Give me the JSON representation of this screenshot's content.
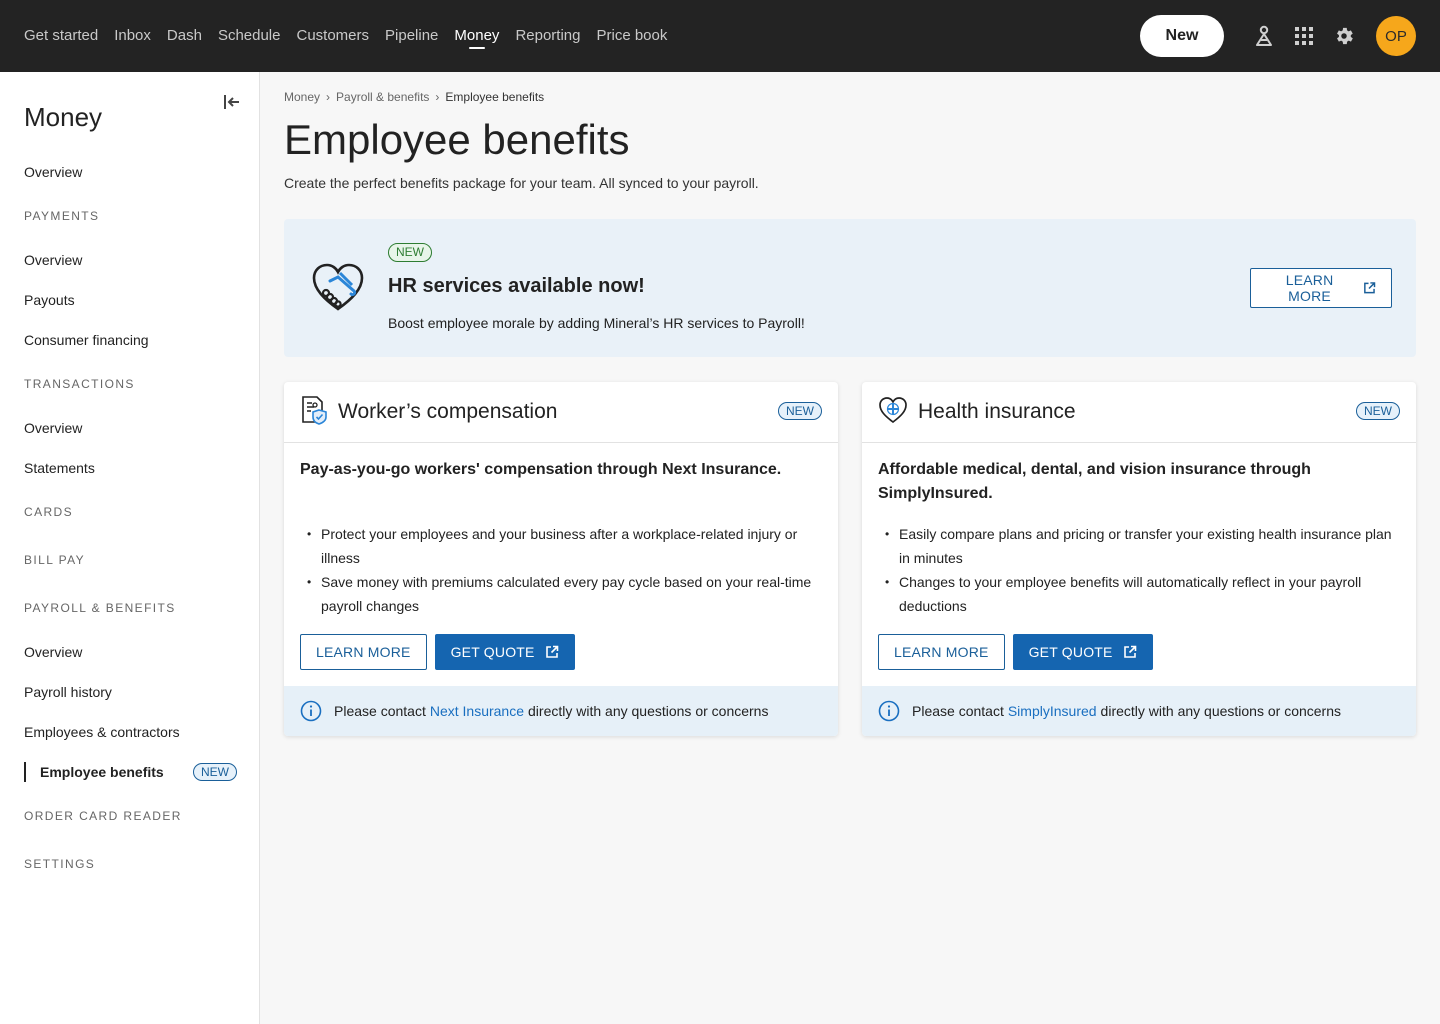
{
  "topnav": {
    "items": [
      {
        "label": "Get started"
      },
      {
        "label": "Inbox"
      },
      {
        "label": "Dash"
      },
      {
        "label": "Schedule"
      },
      {
        "label": "Customers"
      },
      {
        "label": "Pipeline"
      },
      {
        "label": "Money"
      },
      {
        "label": "Reporting"
      },
      {
        "label": "Price book"
      }
    ],
    "active": "Money",
    "new_button": "New",
    "icons": [
      "alert-person-icon",
      "apps-grid-icon",
      "gear-icon"
    ],
    "avatar_initials": "OP",
    "avatar_color": "#f6a71b"
  },
  "sidebar": {
    "title": "Money",
    "overview": "Overview",
    "payments": {
      "header": "PAYMENTS",
      "items": [
        "Overview",
        "Payouts",
        "Consumer financing"
      ]
    },
    "transactions": {
      "header": "TRANSACTIONS",
      "items": [
        "Overview",
        "Statements"
      ]
    },
    "cards_header": "CARDS",
    "bill_pay_header": "BILL PAY",
    "payroll": {
      "header": "PAYROLL & BENEFITS",
      "items": [
        "Overview",
        "Payroll history",
        "Employees & contractors"
      ],
      "active_item": "Employee benefits",
      "active_badge": "NEW"
    },
    "order_card_reader_header": "ORDER CARD READER",
    "settings_header": "SETTINGS"
  },
  "breadcrumb": [
    "Money",
    "Payroll & benefits",
    "Employee benefits"
  ],
  "page": {
    "title": "Employee benefits",
    "subtitle": "Create the perfect benefits package for your team. All synced to your payroll."
  },
  "banner": {
    "badge": "NEW",
    "title": "HR services available now!",
    "text": "Boost employee morale by adding Mineral’s HR services to Payroll!",
    "button": "LEARN MORE"
  },
  "cards": [
    {
      "title": "Worker’s compensation",
      "badge": "NEW",
      "lead": "Pay-as-you-go workers' compensation through Next Insurance.",
      "bullets": [
        "Protect your employees and your business after a workplace-related injury or illness",
        "Save money with premiums calculated every pay cycle based on your real-time payroll changes"
      ],
      "learn_more": "LEARN MORE",
      "get_quote": "GET QUOTE",
      "foot_pre": "Please contact",
      "foot_link": "Next Insurance",
      "foot_post": "directly with any questions or concerns"
    },
    {
      "title": "Health insurance",
      "badge": "NEW",
      "lead": "Affordable medical, dental, and vision insurance through SimplyInsured.",
      "bullets": [
        "Easily compare plans and pricing or transfer your existing health insurance plan in minutes",
        "Changes to your employee benefits will automatically reflect in your payroll deductions"
      ],
      "learn_more": "LEARN MORE",
      "get_quote": "GET QUOTE",
      "foot_pre": "Please contact",
      "foot_link": "SimplyInsured",
      "foot_post": "directly with any questions or concerns"
    }
  ],
  "colors": {
    "topbar": "#232323",
    "accent_blue": "#1565b0",
    "link_blue": "#1a6fc0",
    "banner_bg": "#e9f1f8",
    "new_green": "#2e7d32"
  }
}
